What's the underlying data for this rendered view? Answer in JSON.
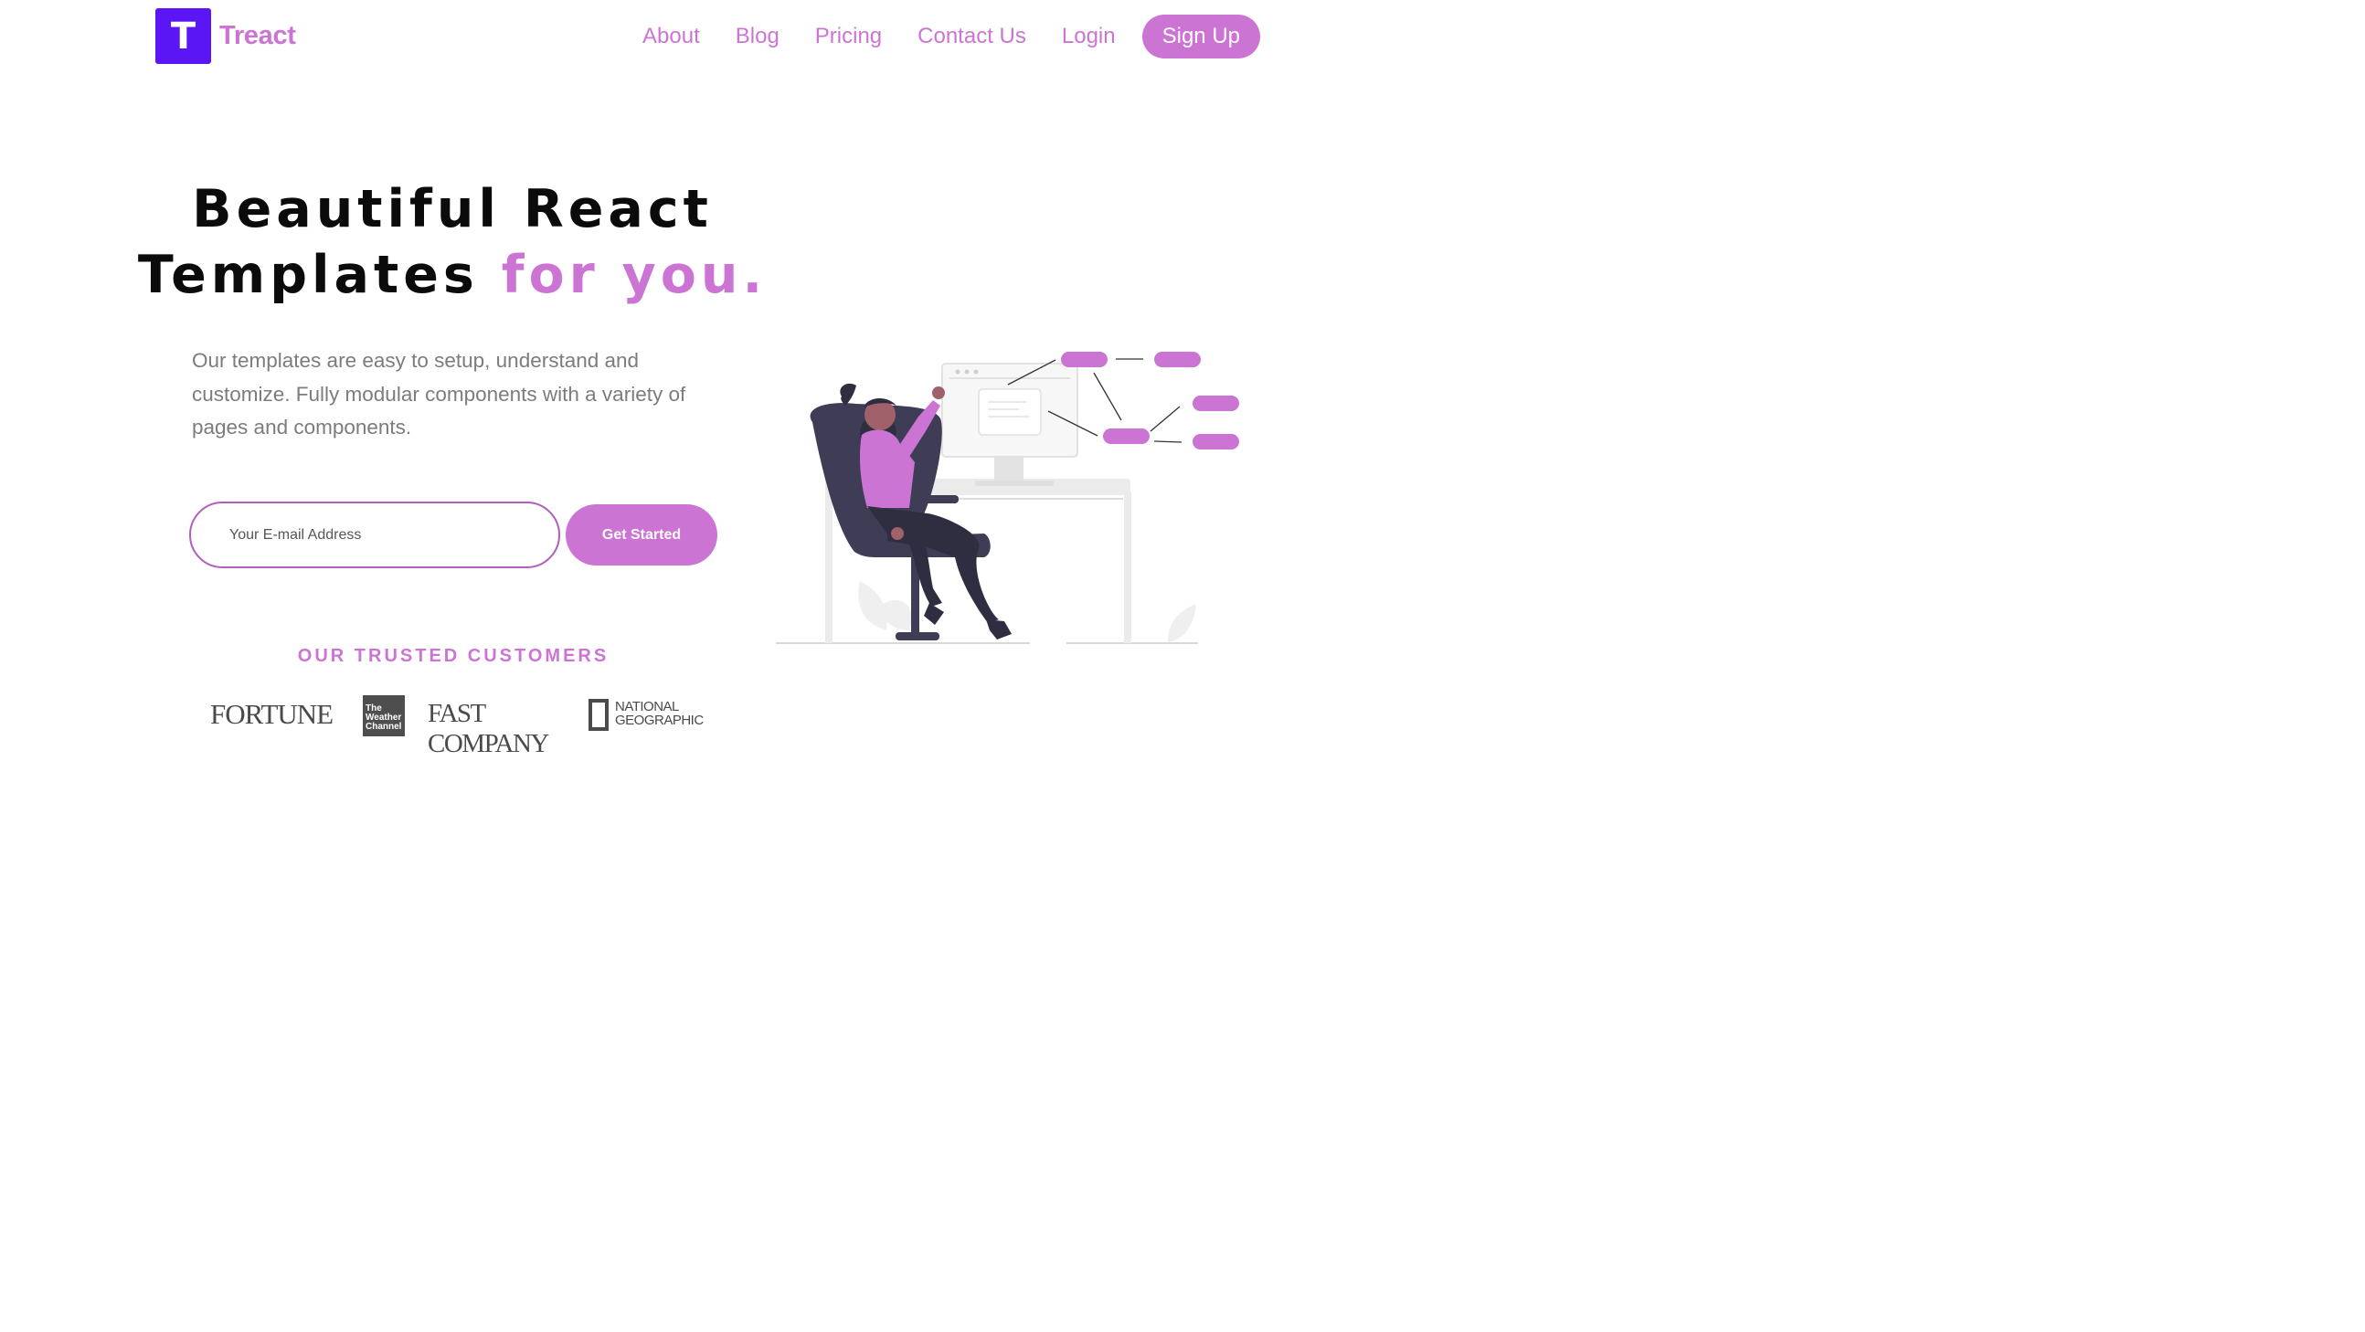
{
  "header": {
    "logo_letter": "T",
    "logo_text": "Treact",
    "nav": [
      "About",
      "Blog",
      "Pricing",
      "Contact Us",
      "Login"
    ],
    "signup_label": "Sign Up"
  },
  "hero": {
    "headline_line1": "Beautiful React",
    "headline_line2_plain": "Templates ",
    "headline_line2_accent": "for you.",
    "description": "Our templates are easy to setup, understand and customize. Fully modular components with a variety of pages and components.",
    "email_placeholder": "Your E-mail Address",
    "cta_label": "Get Started"
  },
  "customers": {
    "heading": "OUR TRUSTED CUSTOMERS",
    "fortune": "FORTUNE",
    "weather_lines": [
      "The",
      "Weather",
      "Channel"
    ],
    "fast_company": "FAST COMPANY",
    "natgeo_lines": [
      "NATIONAL",
      "GEOGRAPHIC"
    ]
  },
  "colors": {
    "accent": "#cc74d4",
    "logo_bg": "#5b16f5",
    "headline": "#0b0b0b",
    "body_text": "#7c7c7c"
  },
  "illustration": {
    "icon": "woman-at-desk-illustration"
  }
}
